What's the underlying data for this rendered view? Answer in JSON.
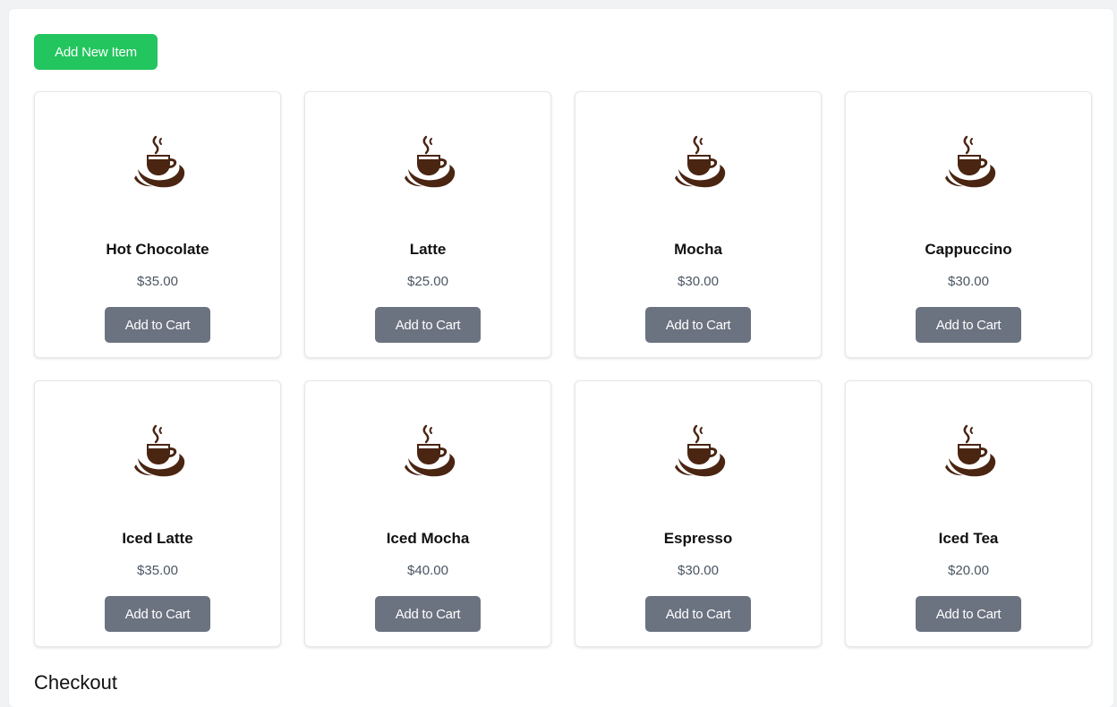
{
  "toolbar": {
    "add_new_label": "Add New Item"
  },
  "products": [
    {
      "name": "Hot Chocolate",
      "price": "$35.00",
      "button": "Add to Cart"
    },
    {
      "name": "Latte",
      "price": "$25.00",
      "button": "Add to Cart"
    },
    {
      "name": "Mocha",
      "price": "$30.00",
      "button": "Add to Cart"
    },
    {
      "name": "Cappuccino",
      "price": "$30.00",
      "button": "Add to Cart"
    },
    {
      "name": "Iced Latte",
      "price": "$35.00",
      "button": "Add to Cart"
    },
    {
      "name": "Iced Mocha",
      "price": "$40.00",
      "button": "Add to Cart"
    },
    {
      "name": "Espresso",
      "price": "$30.00",
      "button": "Add to Cart"
    },
    {
      "name": "Iced Tea",
      "price": "$20.00",
      "button": "Add to Cart"
    }
  ],
  "product_icon": "coffee-cup-icon",
  "colors": {
    "accent": "#22c55e",
    "cart_button": "#6b7280",
    "icon_brown": "#4a2512"
  },
  "checkout": {
    "title": "Checkout"
  }
}
